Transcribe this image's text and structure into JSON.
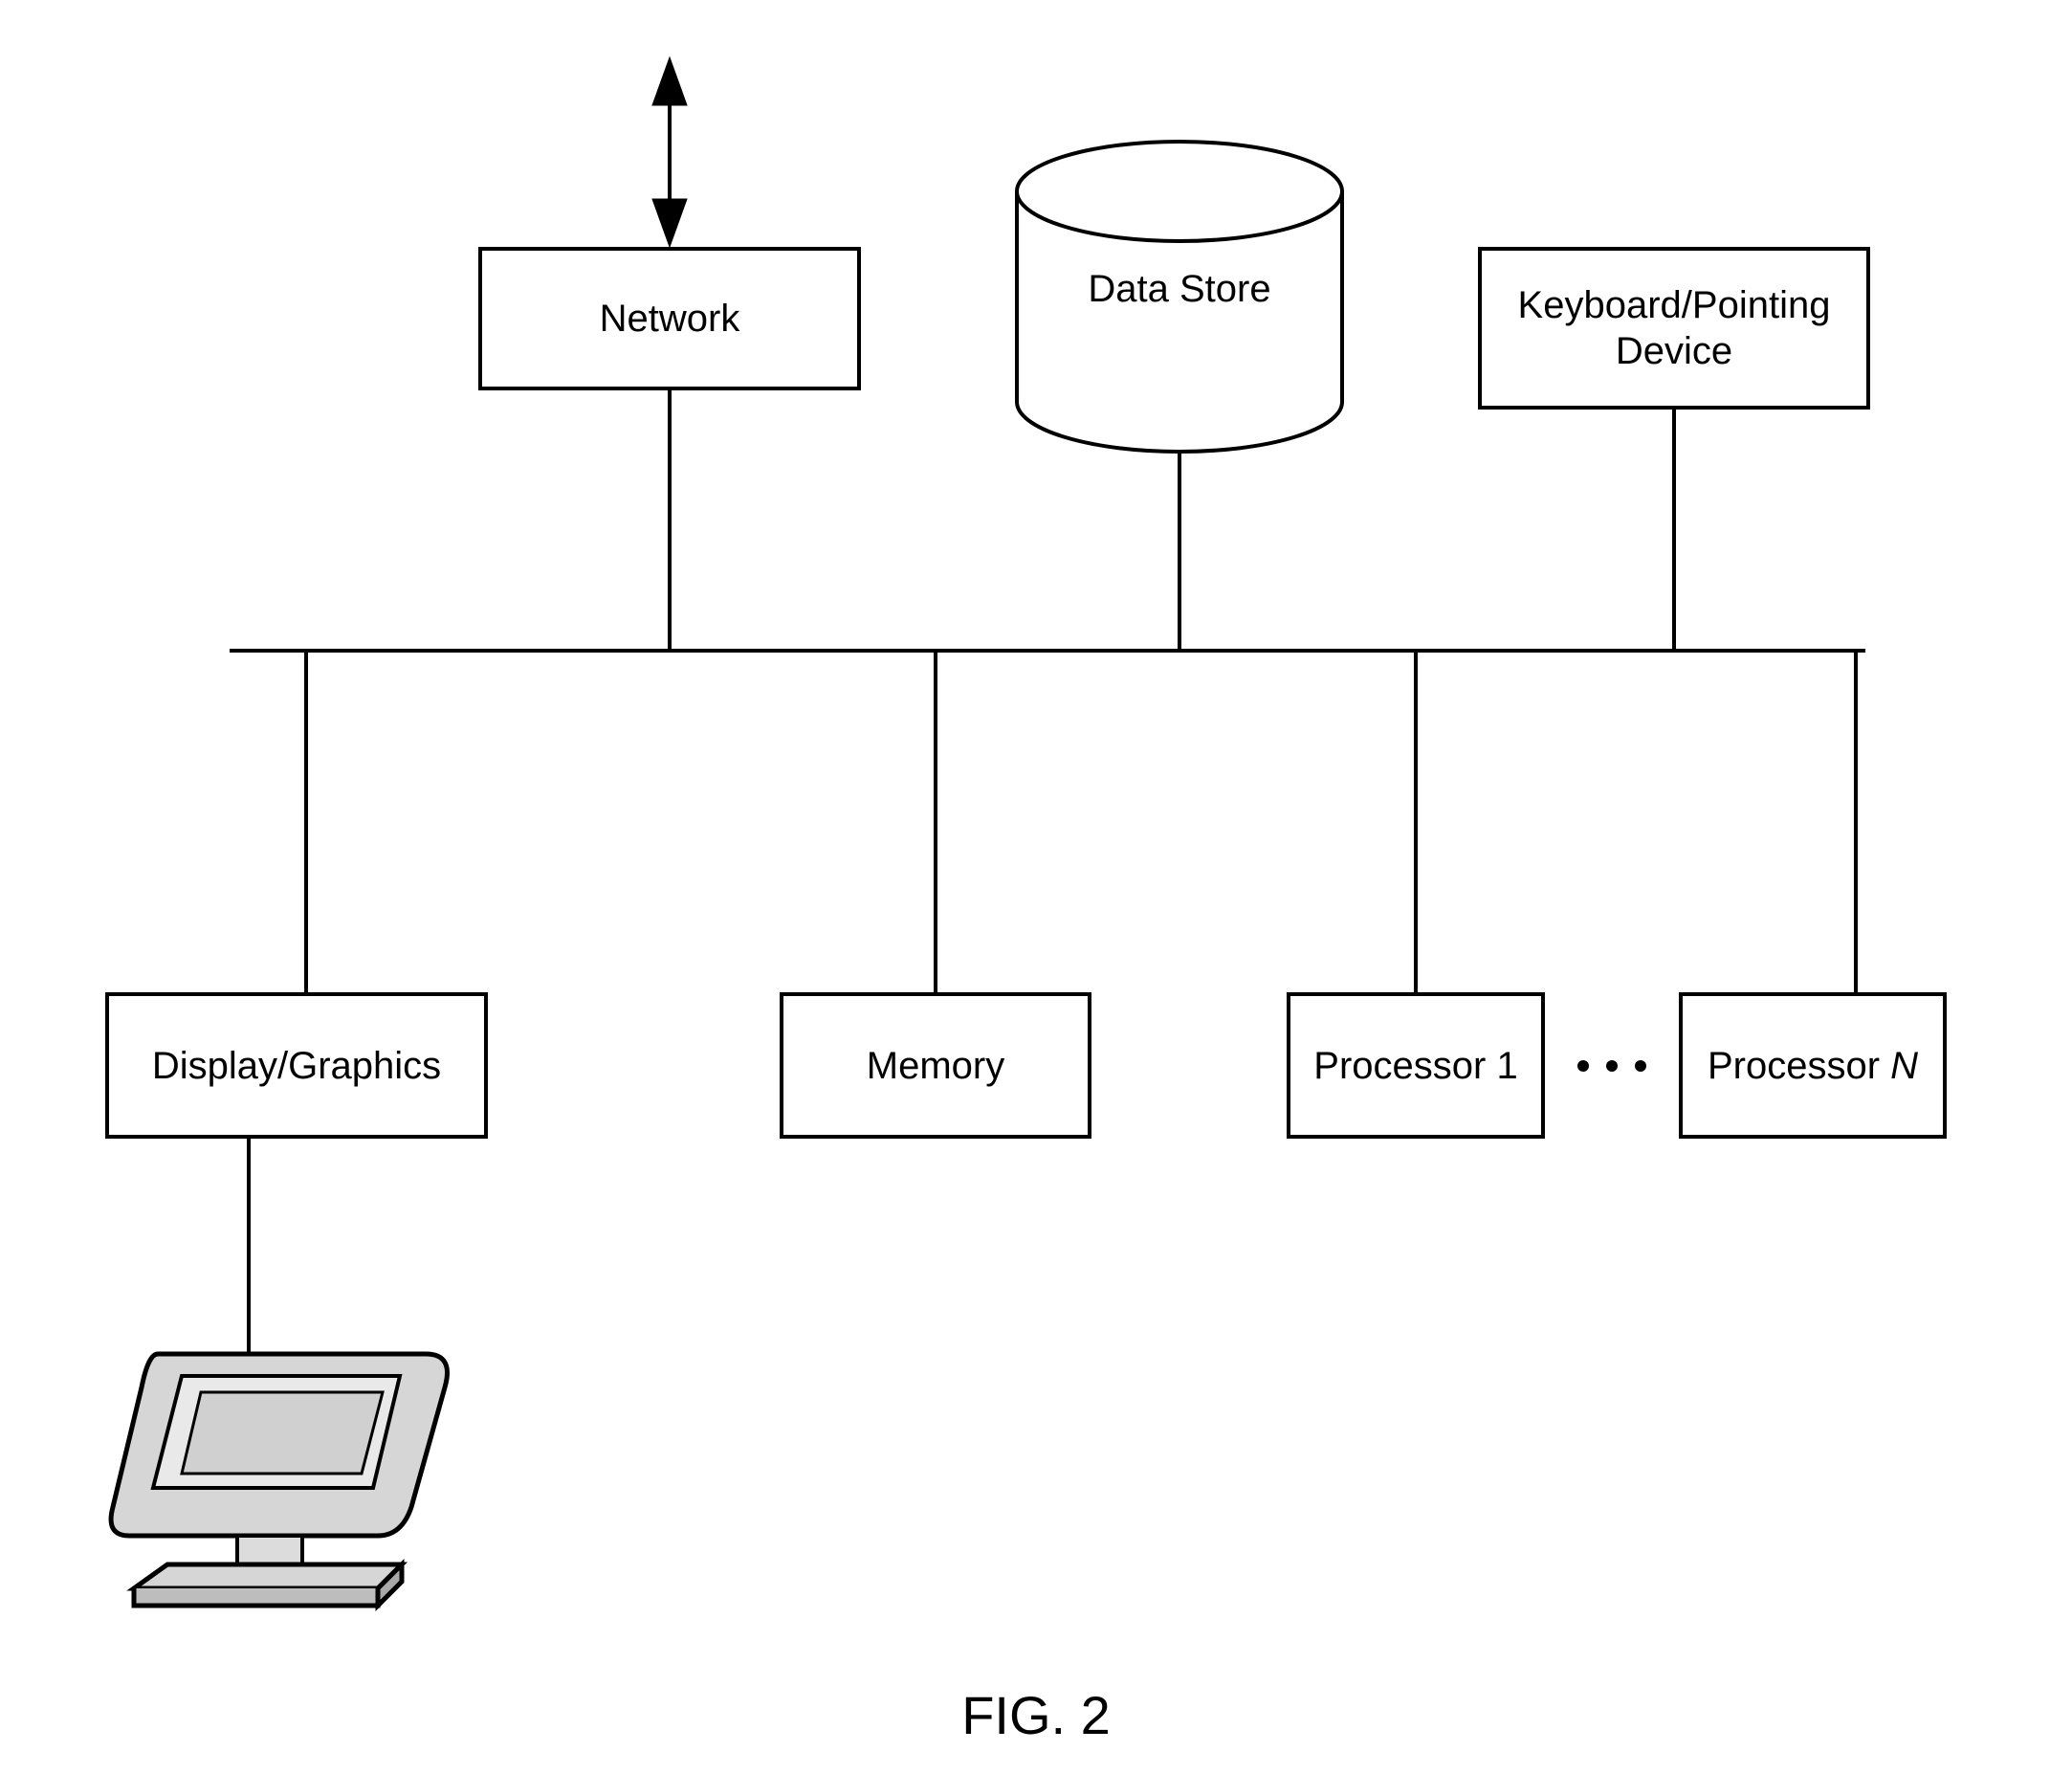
{
  "nodes": {
    "network": "Network",
    "data_store": "Data Store",
    "keyboard": "Keyboard/Pointing\nDevice",
    "display_graphics": "Display/Graphics",
    "memory": "Memory",
    "processor1": "Processor 1",
    "processorN_prefix": "Processor ",
    "processorN_suffix": "N"
  },
  "caption": "FIG. 2"
}
